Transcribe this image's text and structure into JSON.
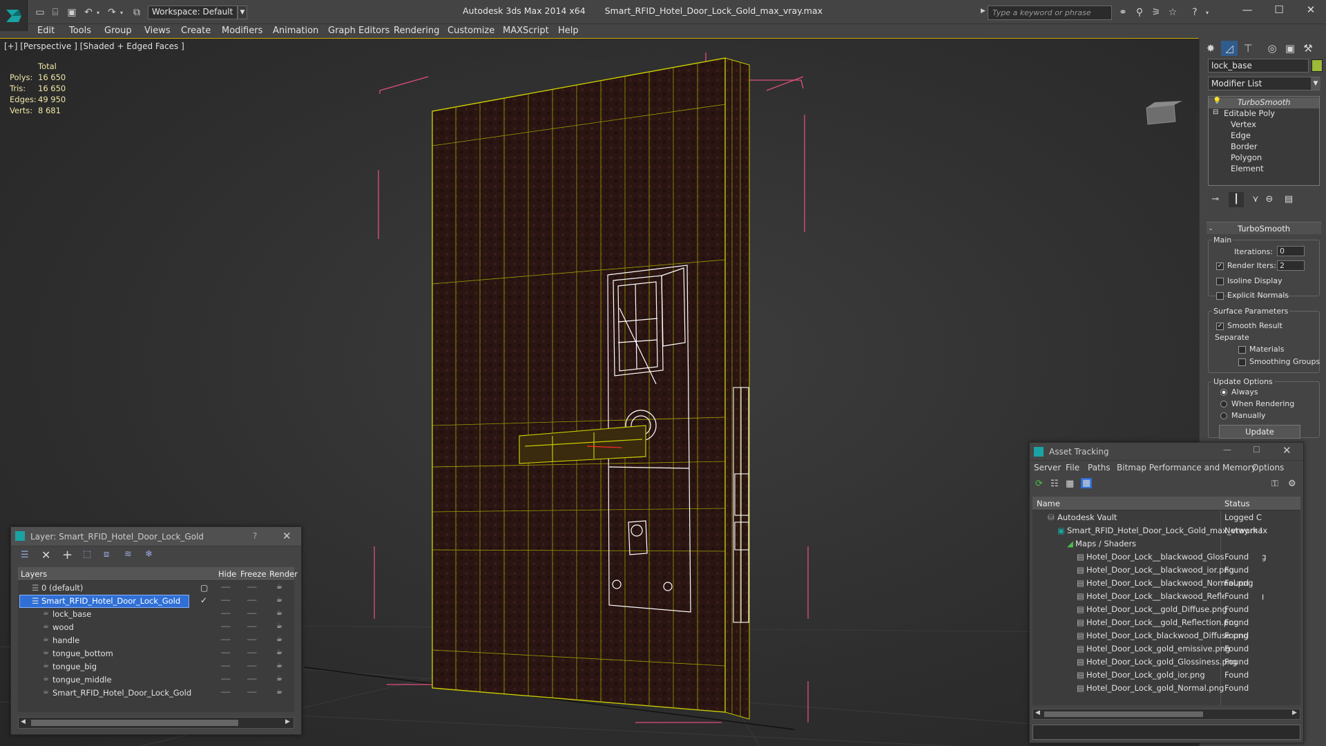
{
  "app": {
    "title": "Autodesk 3ds Max  2014 x64",
    "filename": "Smart_RFID_Hotel_Door_Lock_Gold_max_vray.max",
    "workspace": "Workspace: Default",
    "search_placeholder": "Type a keyword or phrase"
  },
  "menu": [
    "Edit",
    "Tools",
    "Group",
    "Views",
    "Create",
    "Modifiers",
    "Animation",
    "Graph Editors",
    "Rendering",
    "Customize",
    "MAXScript",
    "Help"
  ],
  "viewport": {
    "label": "[+] [Perspective ] [Shaded + Edged Faces ]",
    "stats": {
      "header": "Total",
      "rows": [
        {
          "label": "Polys:",
          "value": "16 650"
        },
        {
          "label": "Tris:",
          "value": "16 650"
        },
        {
          "label": "Edges:",
          "value": "49 950"
        },
        {
          "label": "Verts:",
          "value": "8 681"
        }
      ]
    }
  },
  "command_panel": {
    "object_name": "lock_base",
    "object_color": "#9cba38",
    "modifier_list": "Modifier List",
    "stack": [
      {
        "label": "TurboSmooth",
        "level": 0
      },
      {
        "label": "Editable Poly",
        "level": 0
      },
      {
        "label": "Vertex",
        "level": 1
      },
      {
        "label": "Edge",
        "level": 1
      },
      {
        "label": "Border",
        "level": 1
      },
      {
        "label": "Polygon",
        "level": 1
      },
      {
        "label": "Element",
        "level": 1
      }
    ],
    "turbosmooth": {
      "header": "TurboSmooth",
      "main": "Main",
      "iterations_label": "Iterations:",
      "iterations": "0",
      "render_iters_label": "Render Iters:",
      "render_iters": "2",
      "isoline": "Isoline Display",
      "explicit": "Explicit Normals",
      "surface": "Surface Parameters",
      "smooth": "Smooth Result",
      "separate": "Separate",
      "materials": "Materials",
      "smoothing_groups": "Smoothing Groups",
      "update_options": "Update Options",
      "always": "Always",
      "when_rendering": "When Rendering",
      "manually": "Manually",
      "update": "Update"
    }
  },
  "layer_panel": {
    "title": "Layer: Smart_RFID_Hotel_Door_Lock_Gold",
    "help": "?",
    "columns": {
      "layers": "Layers",
      "hide": "Hide",
      "freeze": "Freeze",
      "render": "Render"
    },
    "rows": [
      {
        "name": "0 (default)",
        "indent": 1,
        "selected": false
      },
      {
        "name": "Smart_RFID_Hotel_Door_Lock_Gold",
        "indent": 1,
        "selected": true
      },
      {
        "name": "lock_base",
        "indent": 2,
        "selected": false
      },
      {
        "name": "wood",
        "indent": 2,
        "selected": false
      },
      {
        "name": "handle",
        "indent": 2,
        "selected": false
      },
      {
        "name": "tongue_bottom",
        "indent": 2,
        "selected": false
      },
      {
        "name": "tongue_big",
        "indent": 2,
        "selected": false
      },
      {
        "name": "tongue_middle",
        "indent": 2,
        "selected": false
      },
      {
        "name": "Smart_RFID_Hotel_Door_Lock_Gold",
        "indent": 2,
        "selected": false
      }
    ]
  },
  "asset_panel": {
    "title": "Asset Tracking",
    "menu": [
      "Server",
      "File",
      "Paths",
      "Bitmap Performance and Memory",
      "Options"
    ],
    "columns": {
      "name": "Name",
      "status": "Status"
    },
    "rows": [
      {
        "name": "Autodesk Vault",
        "status": "Logged C",
        "indent": 1
      },
      {
        "name": "Smart_RFID_Hotel_Door_Lock_Gold_max_vray.max",
        "status": "Network I",
        "indent": 2
      },
      {
        "name": "Maps / Shaders",
        "status": "",
        "indent": 3
      },
      {
        "name": "Hotel_Door_Lock__blackwood_Glossiness.png",
        "status": "Found",
        "indent": 4
      },
      {
        "name": "Hotel_Door_Lock__blackwood_ior.png",
        "status": "Found",
        "indent": 4
      },
      {
        "name": "Hotel_Door_Lock__blackwood_Normal.png",
        "status": "Found",
        "indent": 4
      },
      {
        "name": "Hotel_Door_Lock__blackwood_Reflection.png",
        "status": "Found",
        "indent": 4
      },
      {
        "name": "Hotel_Door_Lock__gold_Diffuse.png",
        "status": "Found",
        "indent": 4
      },
      {
        "name": "Hotel_Door_Lock__gold_Reflection.png",
        "status": "Found",
        "indent": 4
      },
      {
        "name": "Hotel_Door_Lock_blackwood_Diffuse.png",
        "status": "Found",
        "indent": 4
      },
      {
        "name": "Hotel_Door_Lock_gold_emissive.png",
        "status": "Found",
        "indent": 4
      },
      {
        "name": "Hotel_Door_Lock_gold_Glossiness.png",
        "status": "Found",
        "indent": 4
      },
      {
        "name": "Hotel_Door_Lock_gold_ior.png",
        "status": "Found",
        "indent": 4
      },
      {
        "name": "Hotel_Door_Lock_gold_Normal.png",
        "status": "Found",
        "indent": 4
      }
    ]
  },
  "colors": {
    "accent": "#c8a800",
    "selection": "#2f6fd6",
    "wire": "#c8cc00",
    "bbox": "#e0507a"
  }
}
